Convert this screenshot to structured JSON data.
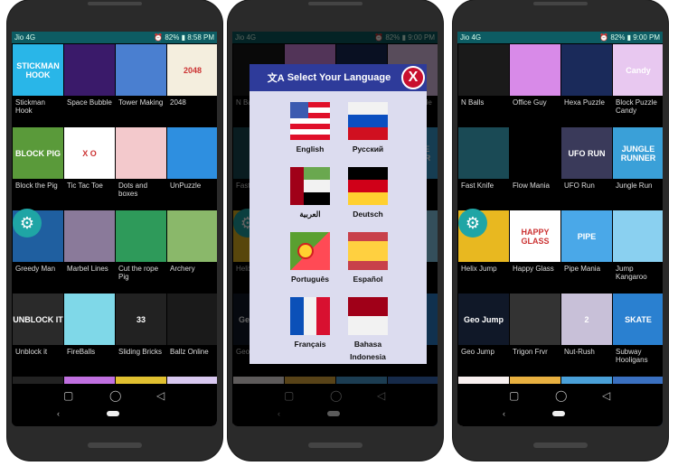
{
  "phones": [
    {
      "status": {
        "left": "Jio 4G",
        "right": "⏰ 82% ▮ 8:58 PM"
      },
      "games": [
        {
          "label": "Stickman Hook",
          "thumb_color": "#29b6e8",
          "thumb_text": "STICKMAN HOOK"
        },
        {
          "label": "Space Bubble",
          "thumb_color": "#3a1a6a",
          "thumb_text": ""
        },
        {
          "label": "Tower Making",
          "thumb_color": "#4a7fd0",
          "thumb_text": ""
        },
        {
          "label": "2048",
          "thumb_color": "#f4eede",
          "thumb_text": "2048"
        },
        {
          "label": "Block the Pig",
          "thumb_color": "#5a9a3a",
          "thumb_text": "BLOCK PIG"
        },
        {
          "label": "Tic Tac Toe",
          "thumb_color": "#ffffff",
          "thumb_text": "X O"
        },
        {
          "label": "Dots and boxes",
          "thumb_color": "#f3c9cc",
          "thumb_text": ""
        },
        {
          "label": "UnPuzzle",
          "thumb_color": "#2e8fe0",
          "thumb_text": ""
        },
        {
          "label": "Greedy Man",
          "thumb_color": "#1f5fa0",
          "thumb_text": ""
        },
        {
          "label": "Marbel Lines",
          "thumb_color": "#8a7a9a",
          "thumb_text": ""
        },
        {
          "label": "Cut the rope Pig",
          "thumb_color": "#2e9a5a",
          "thumb_text": ""
        },
        {
          "label": "Archery",
          "thumb_color": "#8ab86a",
          "thumb_text": ""
        },
        {
          "label": "Unblock it",
          "thumb_color": "#2a2a2a",
          "thumb_text": "UNBLOCK IT"
        },
        {
          "label": "FireBalls",
          "thumb_color": "#7fd8e8",
          "thumb_text": ""
        },
        {
          "label": "Sliding Bricks",
          "thumb_color": "#222222",
          "thumb_text": "33"
        },
        {
          "label": "Ballz Online",
          "thumb_color": "#1a1a1a",
          "thumb_text": ""
        },
        {
          "label": "",
          "thumb_color": "#222222",
          "thumb_text": ""
        },
        {
          "label": "",
          "thumb_color": "#c070e0",
          "thumb_text": ""
        },
        {
          "label": "",
          "thumb_color": "#e0c030",
          "thumb_text": ""
        },
        {
          "label": "",
          "thumb_color": "#d8c8f0",
          "thumb_text": ""
        }
      ]
    },
    {
      "status": {
        "left": "Jio 4G",
        "right": "⏰ 82% ▮ 9:00 PM"
      },
      "dialog": {
        "title": "Select Your Language",
        "close_label": "X",
        "languages": [
          {
            "name": "English",
            "flag": "us"
          },
          {
            "name": "Русский",
            "flag": "ru"
          },
          {
            "name": "العربية",
            "flag": "ae"
          },
          {
            "name": "Deutsch",
            "flag": "de"
          },
          {
            "name": "Português",
            "flag": "pt"
          },
          {
            "name": "Español",
            "flag": "es"
          },
          {
            "name": "Français",
            "flag": "fr"
          },
          {
            "name": "Bahasa Indonesia",
            "flag": "id"
          }
        ]
      }
    },
    {
      "status": {
        "left": "Jio 4G",
        "right": "⏰ 82% ▮ 9:00 PM"
      },
      "games": [
        {
          "label": "N Balls",
          "thumb_color": "#1a1a1a",
          "thumb_text": ""
        },
        {
          "label": "Office Guy",
          "thumb_color": "#d88ae8",
          "thumb_text": ""
        },
        {
          "label": "Hexa Puzzle",
          "thumb_color": "#1a2a5a",
          "thumb_text": ""
        },
        {
          "label": "Block Puzzle Candy",
          "thumb_color": "#e8c8f0",
          "thumb_text": "Candy"
        },
        {
          "label": "Fast Knife",
          "thumb_color": "#1a4a55",
          "thumb_text": ""
        },
        {
          "label": "Flow Mania",
          "thumb_color": "#000000",
          "thumb_text": ""
        },
        {
          "label": "UFO Run",
          "thumb_color": "#3a3a5a",
          "thumb_text": "UFO RUN"
        },
        {
          "label": "Jungle Run",
          "thumb_color": "#3aa0d8",
          "thumb_text": "JUNGLE RUNNER"
        },
        {
          "label": "Helix Jump",
          "thumb_color": "#e8b820",
          "thumb_text": ""
        },
        {
          "label": "Happy Glass",
          "thumb_color": "#ffffff",
          "thumb_text": "HAPPY GLASS"
        },
        {
          "label": "Pipe Mania",
          "thumb_color": "#4aa8e8",
          "thumb_text": "PIPE"
        },
        {
          "label": "Jump Kangaroo",
          "thumb_color": "#8ad0f0",
          "thumb_text": ""
        },
        {
          "label": "Geo Jump",
          "thumb_color": "#101828",
          "thumb_text": "Geo Jump"
        },
        {
          "label": "Trigon Frvr",
          "thumb_color": "#333333",
          "thumb_text": ""
        },
        {
          "label": "Nut-Rush",
          "thumb_color": "#c8c0d8",
          "thumb_text": "2"
        },
        {
          "label": "Subway Hooligans",
          "thumb_color": "#2a80d0",
          "thumb_text": "SKATE"
        },
        {
          "label": "",
          "thumb_color": "#f8f0f0",
          "thumb_text": ""
        },
        {
          "label": "",
          "thumb_color": "#e8b040",
          "thumb_text": ""
        },
        {
          "label": "",
          "thumb_color": "#4aa0d8",
          "thumb_text": "FRUITA"
        },
        {
          "label": "",
          "thumb_color": "#3a70c0",
          "thumb_text": ""
        }
      ]
    }
  ]
}
